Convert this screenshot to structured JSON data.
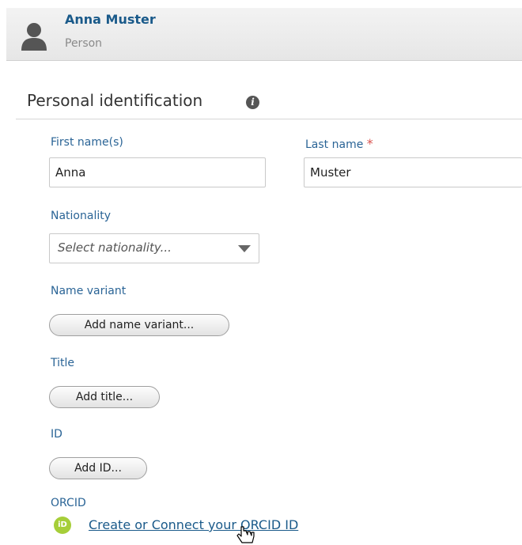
{
  "header": {
    "name": "Anna Muster",
    "type": "Person",
    "icon": "person-icon"
  },
  "section": {
    "title": "Personal identification",
    "info_icon": "info-icon",
    "info_glyph": "i"
  },
  "fields": {
    "first_name": {
      "label": "First name(s)",
      "value": "Anna"
    },
    "last_name": {
      "label": "Last name",
      "required_mark": "*",
      "value": "Muster"
    },
    "nationality": {
      "label": "Nationality",
      "placeholder": "Select nationality..."
    },
    "name_variant": {
      "label": "Name variant",
      "button": "Add name variant..."
    },
    "title": {
      "label": "Title",
      "button": "Add title..."
    },
    "id": {
      "label": "ID",
      "button": "Add ID..."
    },
    "orcid": {
      "label": "ORCID",
      "icon_text": "iD",
      "link": "Create or Connect your ORCID ID"
    }
  },
  "colors": {
    "accent": "#1a5a8a",
    "label": "#2a6496",
    "required": "#d9534f",
    "orcid": "#a6ce39"
  }
}
